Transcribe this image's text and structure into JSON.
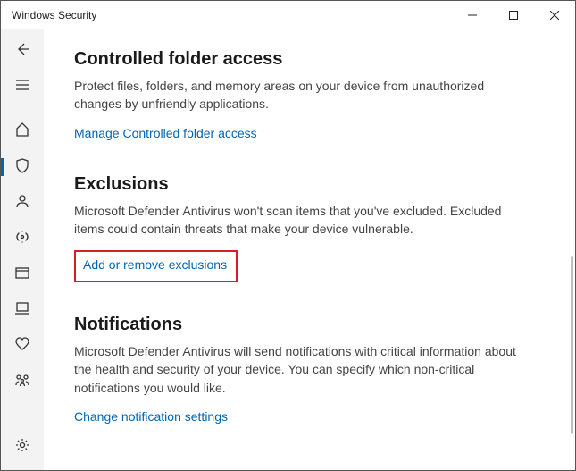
{
  "window": {
    "title": "Windows Security"
  },
  "sidebar": {
    "items": [
      "back",
      "menu",
      "home",
      "shield",
      "account",
      "network",
      "app",
      "device",
      "health",
      "family",
      "settings"
    ]
  },
  "sections": {
    "cfa": {
      "heading": "Controlled folder access",
      "desc": "Protect files, folders, and memory areas on your device from unauthorized changes by unfriendly applications.",
      "link": "Manage Controlled folder access"
    },
    "excl": {
      "heading": "Exclusions",
      "desc": "Microsoft Defender Antivirus won't scan items that you've excluded. Excluded items could contain threats that make your device vulnerable.",
      "link": "Add or remove exclusions"
    },
    "notif": {
      "heading": "Notifications",
      "desc": "Microsoft Defender Antivirus will send notifications with critical information about the health and security of your device. You can specify which non-critical notifications you would like.",
      "link": "Change notification settings"
    }
  }
}
